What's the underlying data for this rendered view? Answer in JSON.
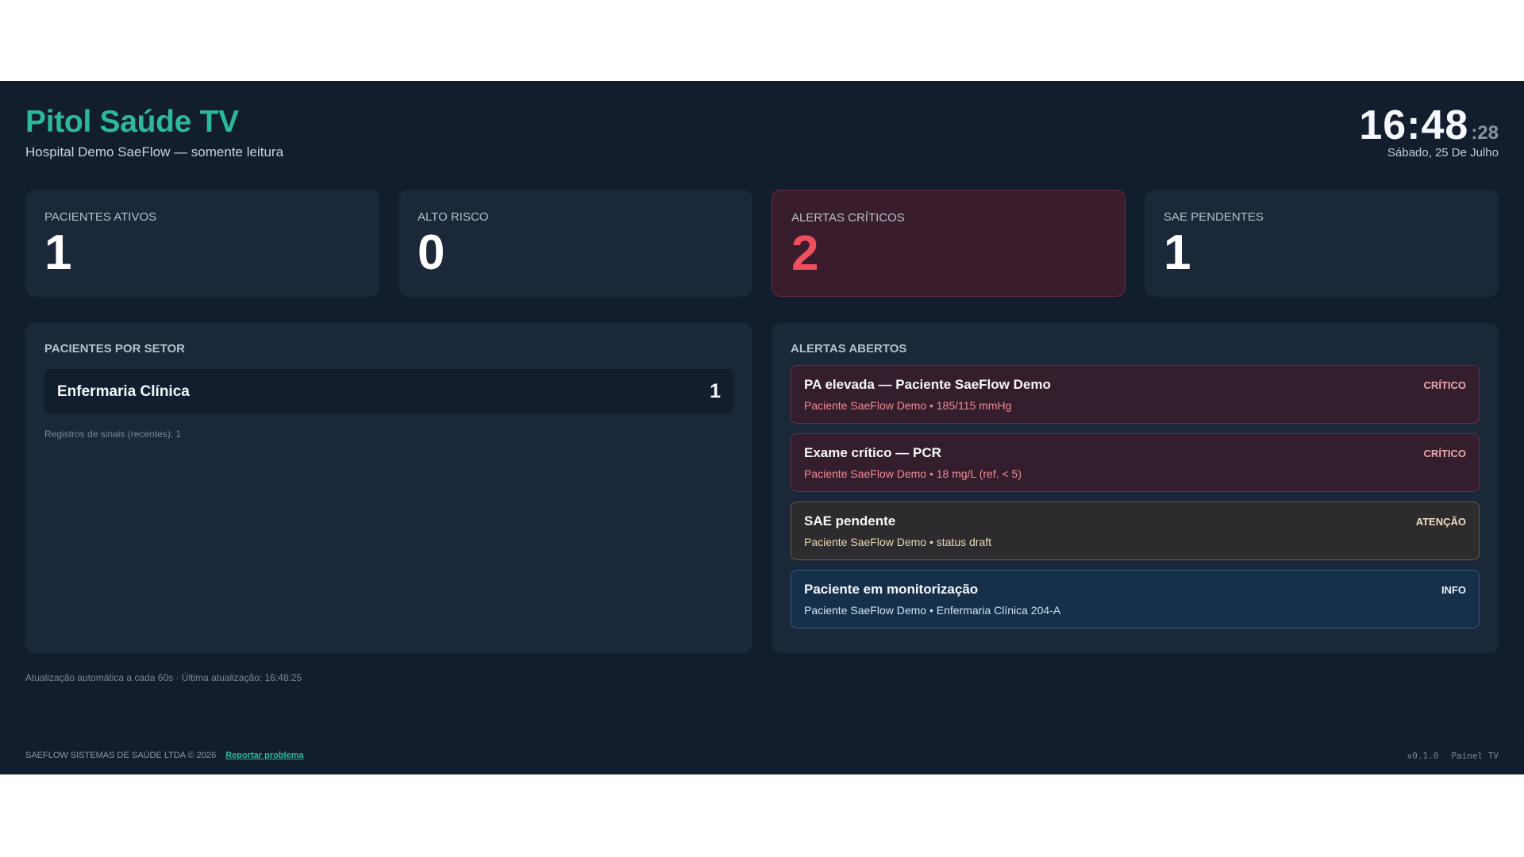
{
  "header": {
    "title": "Pitol Saúde TV",
    "subtitle": "Hospital Demo SaeFlow — somente leitura",
    "clock_hm": "16:48",
    "clock_seconds": ":28",
    "date": "Sábado, 25 De Julho"
  },
  "kpis": [
    {
      "label": "PACIENTES ATIVOS",
      "value": "1"
    },
    {
      "label": "ALTO RISCO",
      "value": "0"
    },
    {
      "label": "ALERTAS CRÍTICOS",
      "value": "2"
    },
    {
      "label": "SAE PENDENTES",
      "value": "1"
    }
  ],
  "sectors": {
    "title": "PACIENTES POR SETOR",
    "items": [
      {
        "name": "Enfermaria Clínica",
        "count": "1"
      }
    ],
    "note": "Registros de sinais (recentes): 1"
  },
  "alerts": {
    "title": "ALERTAS ABERTOS",
    "items": [
      {
        "title": "PA elevada — Paciente SaeFlow Demo",
        "subtitle": "Paciente SaeFlow Demo • 185/115 mmHg",
        "badge": "CRÍTICO"
      },
      {
        "title": "Exame crítico — PCR",
        "subtitle": "Paciente SaeFlow Demo • 18 mg/L (ref. < 5)",
        "badge": "CRÍTICO"
      },
      {
        "title": "SAE pendente",
        "subtitle": "Paciente SaeFlow Demo • status draft",
        "badge": "ATENÇÃO"
      },
      {
        "title": "Paciente em monitorização",
        "subtitle": "Paciente SaeFlow Demo • Enfermaria Clínica 204-A",
        "badge": "INFO"
      }
    ]
  },
  "status": {
    "autorefresh": "Atualização automática a cada 60s · Última atualização: 16:48:25"
  },
  "footer": {
    "copyright": "SAEFLOW SISTEMAS DE SAÚDE LTDA © 2026",
    "report_link": "Reportar problema",
    "version": "v0.1.0",
    "panel_label": "Painel TV"
  },
  "colors": {
    "background": "#121d2e",
    "card": "#1b2839",
    "brand": "#2bb99a",
    "critical": "#f0505e"
  }
}
